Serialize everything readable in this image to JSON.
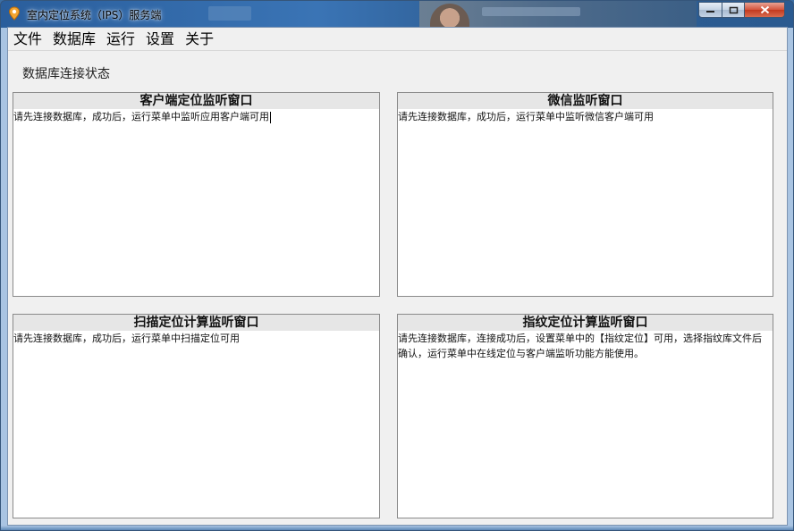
{
  "window": {
    "title": "室内定位系统（IPS）服务端",
    "controls": {
      "minimize": "▭",
      "maximize": "▢",
      "close": "✕"
    }
  },
  "menu": {
    "items": [
      "文件",
      "数据库",
      "运行",
      "设置",
      "关于"
    ]
  },
  "status": {
    "label": "数据库连接状态"
  },
  "panels": [
    {
      "title": "客户端定位监听窗口",
      "text": "请先连接数据库，成功后，运行菜单中监听应用客户端可用"
    },
    {
      "title": "微信监听窗口",
      "text": "请先连接数据库，成功后，运行菜单中监听微信客户端可用"
    },
    {
      "title": "扫描定位计算监听窗口",
      "text": "请先连接数据库，成功后，运行菜单中扫描定位可用"
    },
    {
      "title": "指纹定位计算监听窗口",
      "text": "请先连接数据库，连接成功后，设置菜单中的【指纹定位】可用，选择指纹库文件后确认，运行菜单中在线定位与客户端监听功能方能使用。"
    }
  ],
  "colors": {
    "titlebar": "#2a5e9c",
    "client_bg": "#f0f0f0",
    "panel_header": "#e6e6e6",
    "close_button": "#c23a1f"
  }
}
